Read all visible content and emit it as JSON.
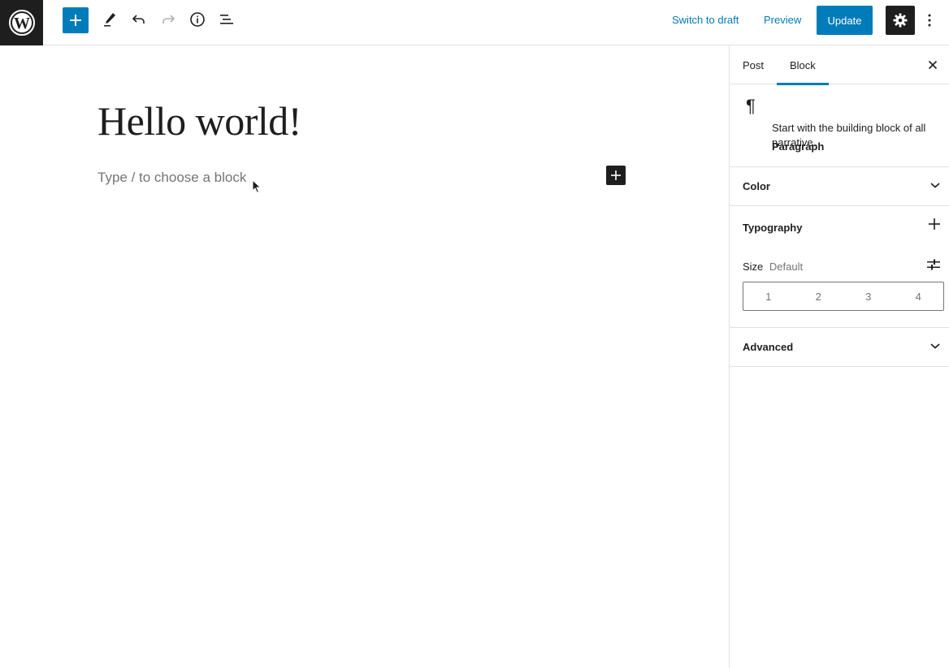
{
  "topbar": {
    "switch_to_draft": "Switch to draft",
    "preview": "Preview",
    "update": "Update",
    "icons": [
      "wordpress-logo-icon",
      "plus-icon",
      "pencil-icon",
      "undo-icon",
      "redo-icon",
      "info-icon",
      "list-view-icon",
      "gear-icon",
      "more-vertical-icon"
    ]
  },
  "editor": {
    "title": "Hello world!",
    "placeholder": "Type / to choose a block"
  },
  "sidebar": {
    "tabs": [
      {
        "label": "Post",
        "active": false
      },
      {
        "label": "Block",
        "active": true
      }
    ],
    "block_card": {
      "icon": "¶",
      "title": "Paragraph",
      "description": "Start with the building block of all narrative."
    },
    "panels": {
      "color": "Color",
      "typography": "Typography",
      "advanced": "Advanced"
    },
    "size": {
      "label": "Size",
      "value": "Default",
      "options": [
        "1",
        "2",
        "3",
        "4"
      ]
    }
  },
  "colors": {
    "accent": "#007cba",
    "dark": "#1e1e1e",
    "muted": "#757575",
    "border": "#e0e0e0"
  }
}
